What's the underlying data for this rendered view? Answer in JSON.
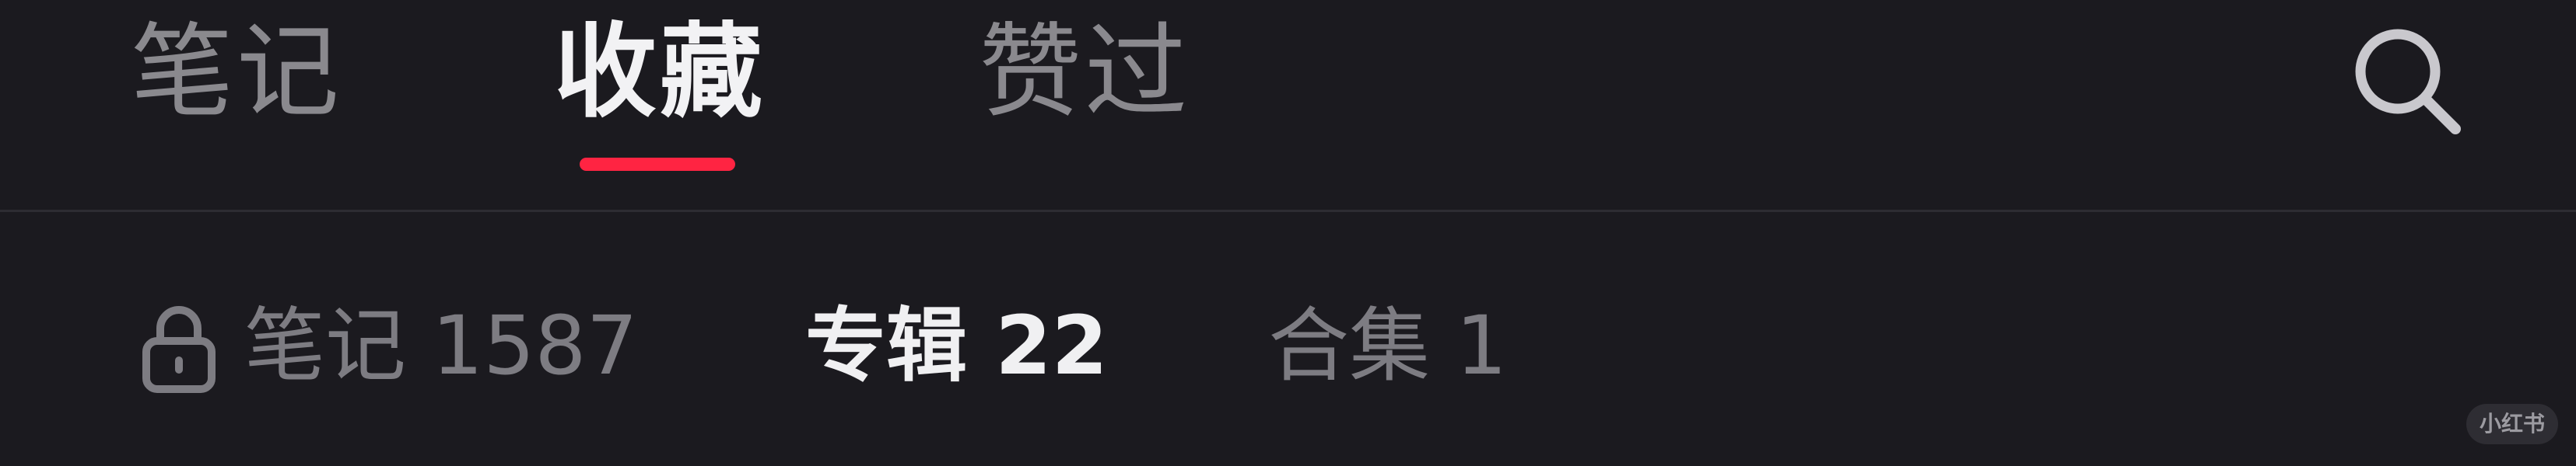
{
  "tabs": [
    {
      "label": "笔记",
      "active": false
    },
    {
      "label": "收藏",
      "active": true
    },
    {
      "label": "赞过",
      "active": false
    }
  ],
  "accent_color": "#ff2442",
  "search": {
    "icon": "search-icon"
  },
  "subtabs": [
    {
      "label": "笔记 1587",
      "icon": "lock-icon",
      "active": false
    },
    {
      "label": "专辑 22",
      "active": true
    },
    {
      "label": "合集 1",
      "active": false
    }
  ],
  "watermark": {
    "text": "小红书"
  }
}
